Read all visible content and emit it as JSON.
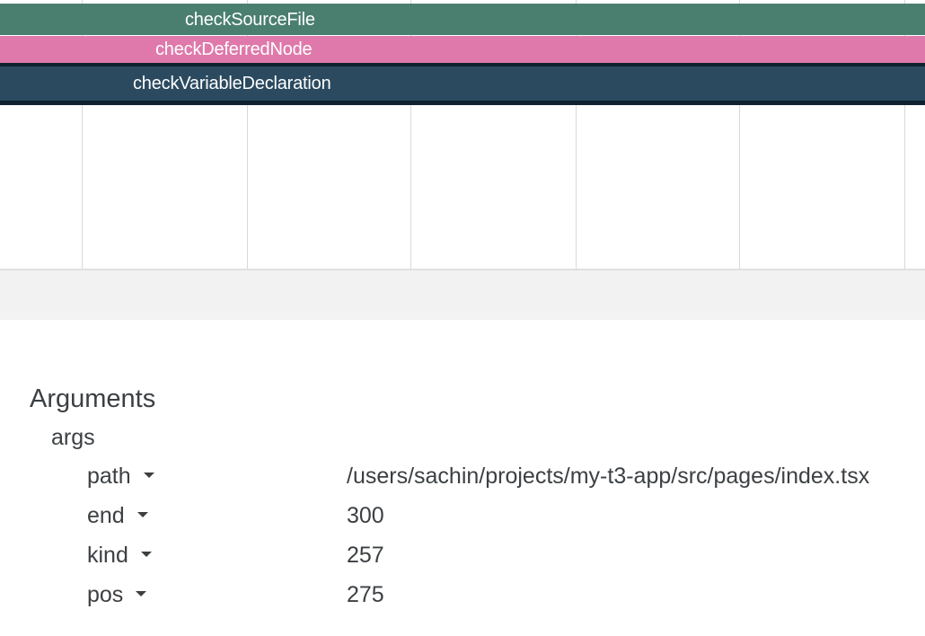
{
  "flame": {
    "slices": [
      {
        "label": "checkSourceFile",
        "color": "#4a7f70"
      },
      {
        "label": "checkDeferredNode",
        "color": "#df79ab"
      },
      {
        "label": "checkVariableDeclaration",
        "color": "#2b4a5f"
      }
    ]
  },
  "details": {
    "section_title": "Arguments",
    "group_title": "args",
    "rows": [
      {
        "key": "path",
        "value": "/users/sachin/projects/my-t3-app/src/pages/index.tsx"
      },
      {
        "key": "end",
        "value": "300"
      },
      {
        "key": "kind",
        "value": "257"
      },
      {
        "key": "pos",
        "value": "275"
      }
    ],
    "expand_icon": "caret-down-icon"
  }
}
